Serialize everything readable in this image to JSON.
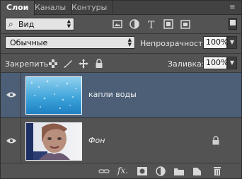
{
  "tabs": [
    {
      "label": "Слои",
      "active": true
    },
    {
      "label": "Каналы",
      "active": false
    },
    {
      "label": "Контуры",
      "active": false
    }
  ],
  "filter": {
    "icon": "search-icon",
    "value": "Вид"
  },
  "filter_buttons": [
    "image-filter-icon",
    "adjustment-filter-icon",
    "type-filter-icon",
    "shape-filter-icon",
    "smart-object-filter-icon"
  ],
  "blend_mode": {
    "value": "Обычные"
  },
  "opacity": {
    "label": "Непрозрачность:",
    "value": "100%"
  },
  "lock": {
    "label": "Закрепить:",
    "icons": [
      "lock-transparency-icon",
      "lock-pixels-icon",
      "lock-position-icon",
      "lock-all-icon"
    ]
  },
  "fill": {
    "label": "Заливка:",
    "value": "100%"
  },
  "layers": [
    {
      "name": "капли воды",
      "visible": true,
      "selected": true,
      "locked": false
    },
    {
      "name": "Фон",
      "visible": true,
      "selected": false,
      "locked": true
    }
  ],
  "bottom_toolbar": [
    "link-layers-icon",
    "fx-icon",
    "add-mask-icon",
    "adjustment-layer-icon",
    "new-group-icon",
    "new-layer-icon",
    "delete-layer-icon"
  ],
  "bottom_fx_label": "fx.",
  "colors": {
    "panel": "#535353",
    "selected_layer": "#4c5f77",
    "tabbar": "#424242"
  }
}
